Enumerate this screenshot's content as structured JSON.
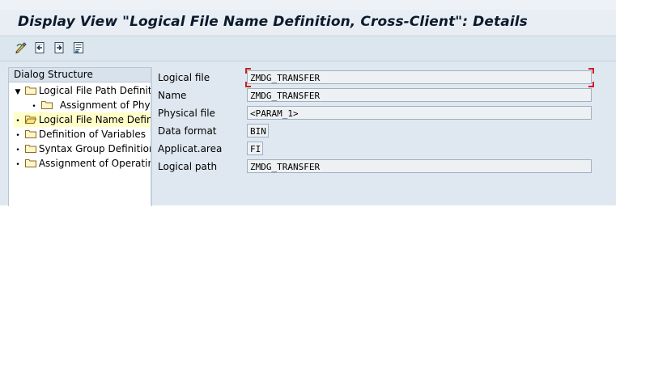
{
  "window": {
    "title": "Display View \"Logical File Name Definition, Cross-Client\": Details"
  },
  "toolbar": {
    "buttons": [
      {
        "icon": "display-change-icon"
      },
      {
        "icon": "previous-entry-icon"
      },
      {
        "icon": "next-entry-icon"
      },
      {
        "icon": "variable-list-icon"
      }
    ]
  },
  "dialog_structure": {
    "header": "Dialog Structure",
    "items": [
      {
        "label": "Logical File Path Definitio",
        "level": 0,
        "expander": "▼",
        "selected": false
      },
      {
        "label": "Assignment of Physi",
        "level": 1,
        "expander": "•",
        "selected": false
      },
      {
        "label": "Logical File Name Definiti",
        "level": 0,
        "expander": "•",
        "selected": true
      },
      {
        "label": "Definition of Variables",
        "level": 0,
        "expander": "•",
        "selected": false
      },
      {
        "label": "Syntax Group Definition",
        "level": 0,
        "expander": "•",
        "selected": false
      },
      {
        "label": "Assignment of Operating",
        "level": 0,
        "expander": "•",
        "selected": false
      }
    ]
  },
  "form": {
    "logical_file": {
      "label": "Logical file",
      "value": "ZMDG_TRANSFER"
    },
    "name": {
      "label": "Name",
      "value": "ZMDG_TRANSFER"
    },
    "physical_file": {
      "label": "Physical file",
      "value": "<PARAM_1>"
    },
    "data_format": {
      "label": "Data format",
      "value": "BIN"
    },
    "application_area": {
      "label": "Applicat.area",
      "value": "FI"
    },
    "logical_path": {
      "label": "Logical path",
      "value": "ZMDG_TRANSFER"
    }
  },
  "colors": {
    "selected_row": "#ffffc8",
    "focus_corner": "#cc2020",
    "background": "#dfe8f0"
  }
}
